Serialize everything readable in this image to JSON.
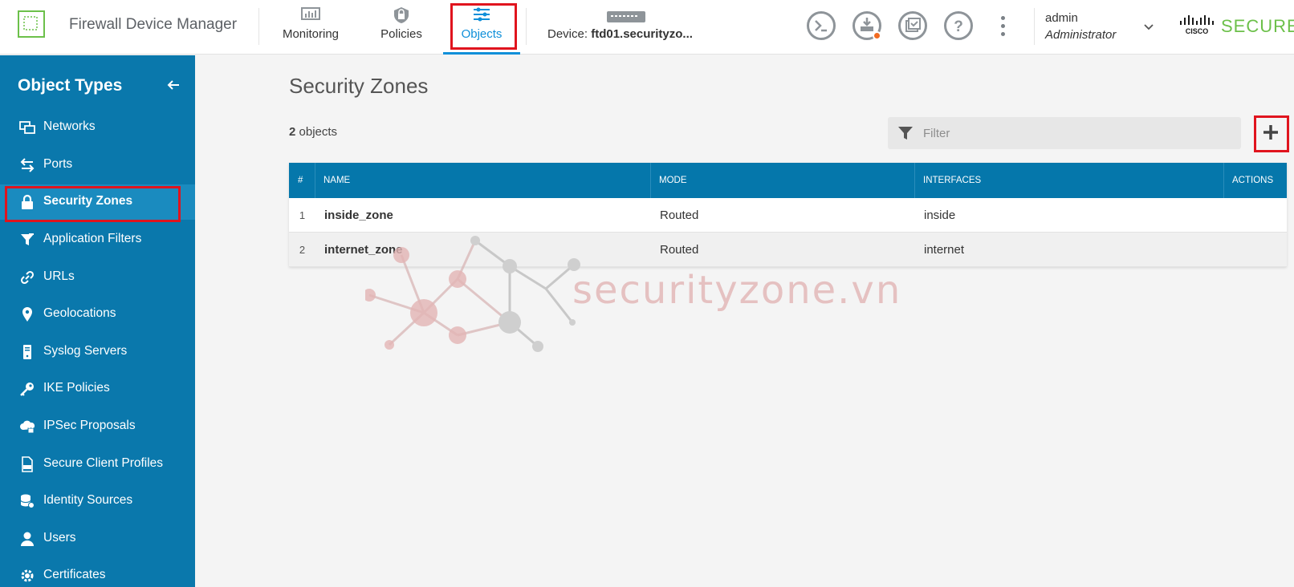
{
  "header": {
    "app_title": "Firewall Device Manager",
    "nav": [
      {
        "label": "Monitoring",
        "icon": "monitoring-icon"
      },
      {
        "label": "Policies",
        "icon": "policies-icon"
      },
      {
        "label": "Objects",
        "icon": "objects-icon",
        "active": true
      }
    ],
    "device_label": "Device:",
    "device_name": "ftd01.securityzo...",
    "user": {
      "name": "admin",
      "role": "Administrator"
    },
    "brand_secure": "SECURE",
    "brand_cisco": "CISCO",
    "accent_color": "#0f8fd9"
  },
  "sidebar": {
    "title": "Object Types",
    "items": [
      {
        "label": "Networks",
        "icon": "networks-icon"
      },
      {
        "label": "Ports",
        "icon": "ports-icon"
      },
      {
        "label": "Security Zones",
        "icon": "lock-icon",
        "active": true
      },
      {
        "label": "Application Filters",
        "icon": "application-filters-icon"
      },
      {
        "label": "URLs",
        "icon": "link-icon"
      },
      {
        "label": "Geolocations",
        "icon": "location-pin-icon"
      },
      {
        "label": "Syslog Servers",
        "icon": "server-icon"
      },
      {
        "label": "IKE Policies",
        "icon": "key-icon"
      },
      {
        "label": "IPSec Proposals",
        "icon": "cloud-lock-icon"
      },
      {
        "label": "Secure Client Profiles",
        "icon": "xml-file-icon"
      },
      {
        "label": "Identity Sources",
        "icon": "database-icon"
      },
      {
        "label": "Users",
        "icon": "user-icon"
      },
      {
        "label": "Certificates",
        "icon": "gear-icon"
      }
    ],
    "bg_color": "#0a78ac"
  },
  "main": {
    "title": "Security Zones",
    "count": "2",
    "count_suffix": "objects",
    "filter_placeholder": "Filter",
    "table": {
      "columns": [
        "#",
        "NAME",
        "MODE",
        "INTERFACES",
        "ACTIONS"
      ],
      "rows": [
        {
          "num": "1",
          "name": "inside_zone",
          "mode": "Routed",
          "interfaces": "inside"
        },
        {
          "num": "2",
          "name": "internet_zone",
          "mode": "Routed",
          "interfaces": "internet"
        }
      ]
    }
  },
  "watermark": {
    "text": "securityzone.vn"
  }
}
